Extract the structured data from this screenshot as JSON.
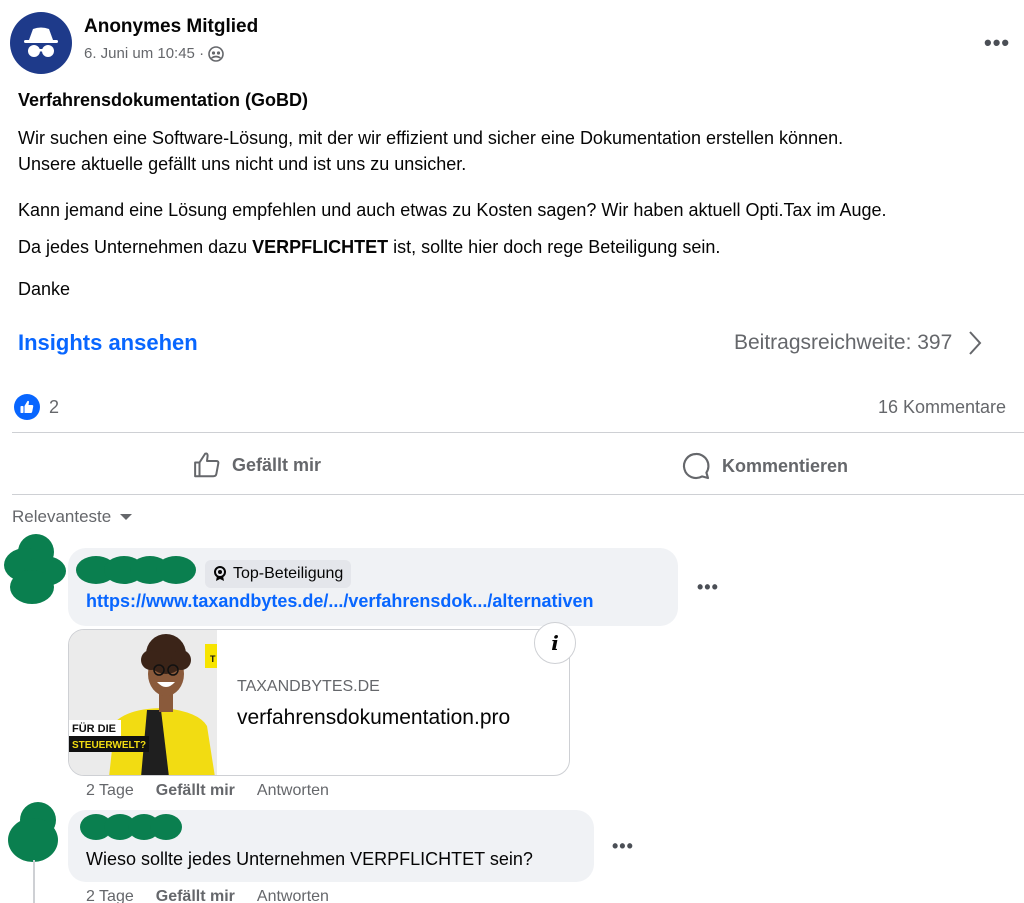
{
  "post": {
    "author": "Anonymes Mitglied",
    "date": "6. Juni um 10:45 ·",
    "more": "•••",
    "title": "Verfahrensdokumentation (GoBD)",
    "p1_line1": "Wir suchen eine Software-Lösung, mit der wir effizient und sicher eine Dokumentation erstellen können.",
    "p1_line2": "Unsere aktuelle gefällt uns nicht und ist uns zu unsicher.",
    "p2": "Kann jemand eine Lösung empfehlen und auch etwas zu Kosten sagen? Wir haben aktuell Opti.Tax im Auge.",
    "p3_before": "Da jedes Unternehmen dazu ",
    "p3_bold": "VERPFLICHTET",
    "p3_after": " ist, sollte hier doch rege Beteiligung sein.",
    "p4": "Danke"
  },
  "insights": {
    "link_label": "Insights ansehen",
    "reach_label": "Beitragsreichweite: 397"
  },
  "stats": {
    "likes": "2",
    "comments": "16 Kommentare"
  },
  "actions": {
    "like": "Gefällt mir",
    "comment": "Kommentieren"
  },
  "sort": {
    "label": "Relevanteste"
  },
  "comments": [
    {
      "badge": "Top-Beteiligung",
      "link": "https://www.taxandbytes.de/.../verfahrensdok.../alternativen",
      "card_domain": "TAXANDBYTES.DE",
      "card_title": "verfahrensdokumentation.pro",
      "card_img_text_1": "FÜR DIE",
      "card_img_text_2": "STEUERWELT?",
      "card_img_text_3": "T",
      "time": "2 Tage",
      "like": "Gefällt mir",
      "reply": "Antworten",
      "more": "•••"
    },
    {
      "text": "Wieso sollte jedes Unternehmen VERPFLICHTET sein?",
      "time": "2 Tage",
      "like": "Gefällt mir",
      "reply": "Antworten",
      "more": "•••"
    }
  ],
  "colors": {
    "accent": "#0866ff",
    "redaction": "#0a7f4f",
    "avatar": "#1e3a8a"
  }
}
